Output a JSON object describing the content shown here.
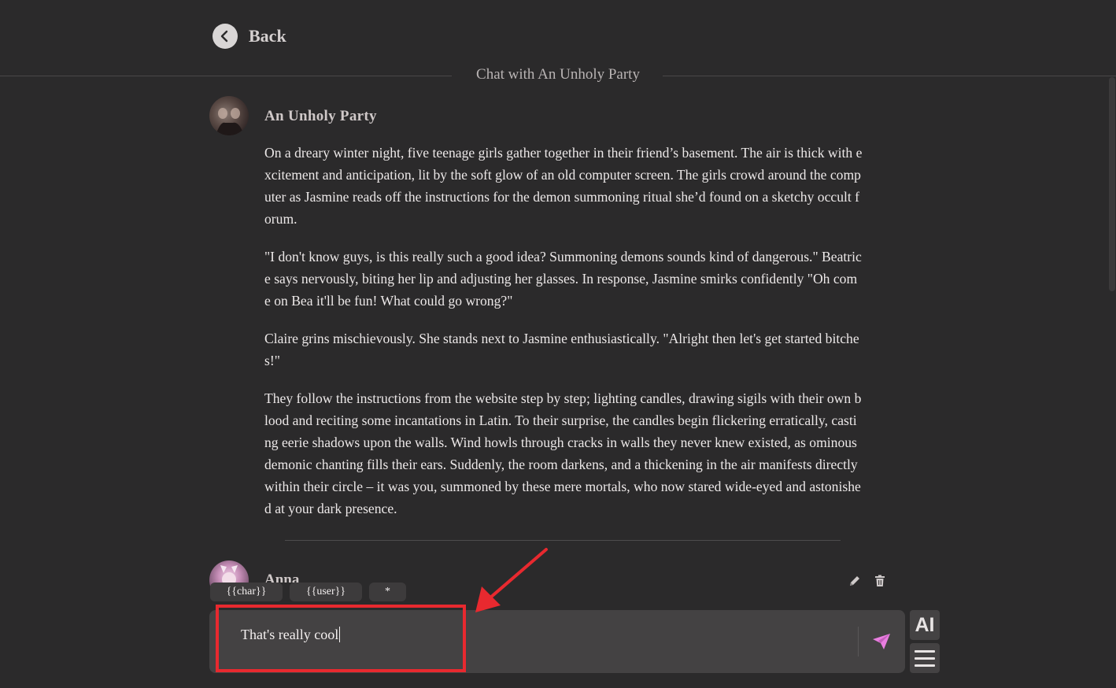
{
  "header": {
    "back_label": "Back",
    "chat_title": "Chat with An Unholy Party"
  },
  "message": {
    "character_name": "An Unholy Party",
    "paragraphs": [
      "On a dreary winter night, five teenage girls gather together in their friend’s basement. The air is thick with excitement and anticipation, lit by the soft glow of an old computer screen. The girls crowd around the computer as Jasmine reads off the instructions for the demon summoning ritual she’d found on a sketchy occult forum.",
      "\"I don't know guys, is this really such a good idea? Summoning demons sounds kind of dangerous.\" Beatrice says nervously, biting her lip and adjusting her glasses. In response, Jasmine smirks confidently \"Oh come on Bea it'll be fun! What could go wrong?\"",
      "Claire grins mischievously. She stands next to Jasmine enthusiastically. \"Alright then let's get started bitches!\"",
      "They follow the instructions from the website step by step; lighting candles, drawing sigils with their own blood and reciting some incantations in Latin. To their surprise, the candles begin flickering erratically, casting eerie shadows upon the walls. Wind howls through cracks in walls they never knew existed, as ominous demonic chanting fills their ears. Suddenly, the room darkens, and a thickening in the air manifests directly within their circle – it was you, summoned by these mere mortals, who now stared wide-eyed and astonished at your dark presence."
    ]
  },
  "user_message": {
    "user_name": "Anna"
  },
  "macros": {
    "char": "{{char}}",
    "user": "{{user}}",
    "asterisk": "*"
  },
  "composer": {
    "input_value": "That's really cool",
    "ai_label": "AI"
  },
  "colors": {
    "background": "#2b2a2b",
    "input_bg": "#444243",
    "send_icon": "#e97ee0",
    "annotation": "#e8292f"
  },
  "icons": [
    "back-arrow-icon",
    "pencil-icon",
    "trash-icon",
    "send-icon",
    "menu-icon"
  ]
}
